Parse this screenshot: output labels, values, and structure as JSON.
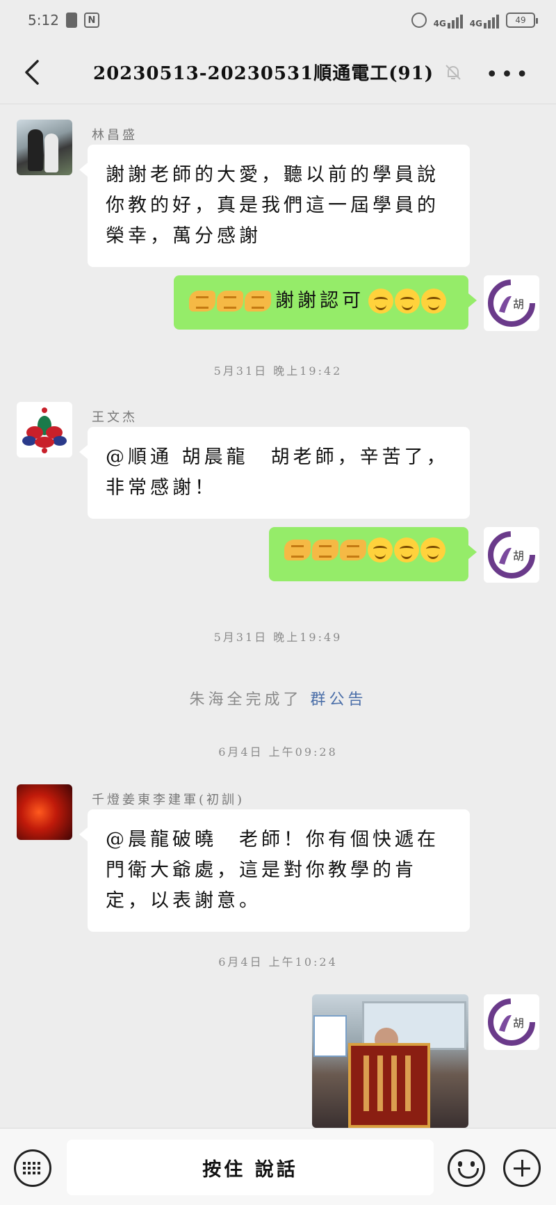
{
  "status_bar": {
    "time": "5:12",
    "signal1": "4G",
    "signal2": "4G",
    "battery": "49"
  },
  "header": {
    "title": "20230513-20230531順通電工(91)",
    "back_icon": "chevron-left-icon",
    "mute_icon": "bell-muted-icon",
    "more_icon": "more-horizontal-icon"
  },
  "messages": [
    {
      "sender": "林昌盛",
      "text": "謝謝老師的大愛，聽以前的學員說你教的好，真是我們這一屆學員的榮幸，萬分感謝"
    },
    {
      "text": "謝謝認可"
    }
  ],
  "timestamps": [
    "5月31日 晚上19:42",
    "5月31日 晚上19:49",
    "6月4日 上午09:28",
    "6月4日 上午10:24"
  ],
  "message2": {
    "sender": "王文杰",
    "text": "@順通 胡晨龍　胡老師，辛苦了，非常感謝！"
  },
  "system_notice": {
    "prefix": "朱海全完成了",
    "link": "群公告"
  },
  "message3": {
    "sender": "千燈姜東李建軍(初訓)",
    "text": "@晨龍破曉　老師！你有個快遞在門衛大爺處，這是對你教學的肯定，以表謝意。"
  },
  "self_avatar_label": "胡",
  "input_bar": {
    "hold_to_talk": "按住 說話",
    "keyboard_icon": "keyboard-icon",
    "emoji_icon": "emoji-icon",
    "plus_icon": "plus-icon"
  }
}
